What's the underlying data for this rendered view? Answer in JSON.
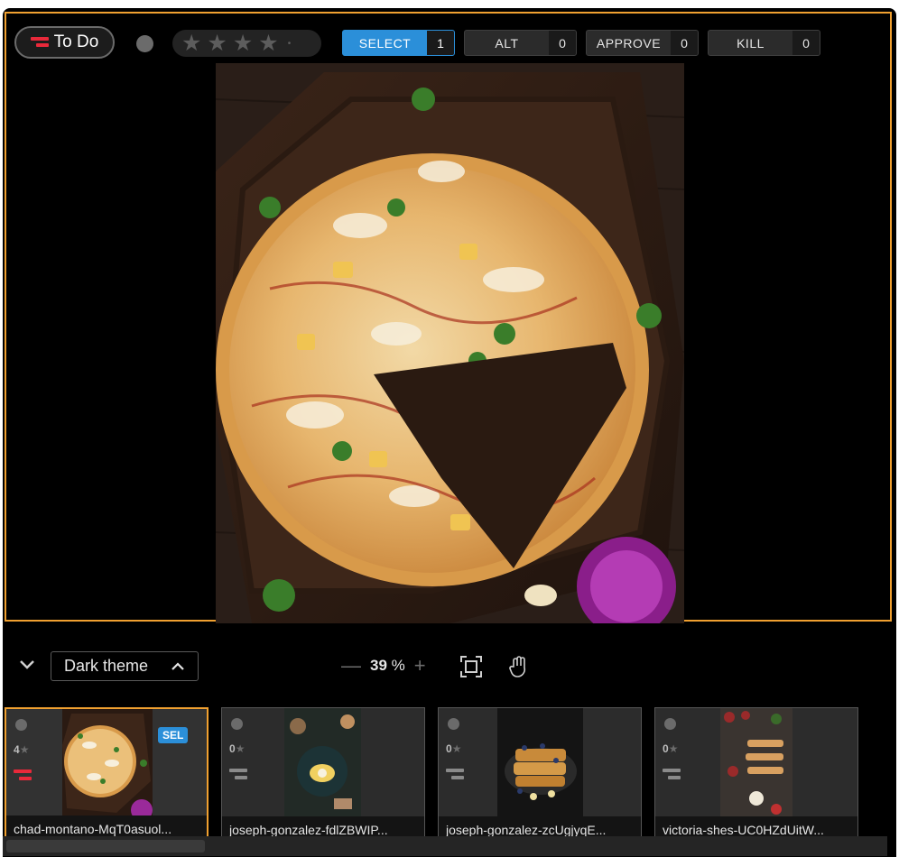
{
  "toolbar": {
    "status_label": "To Do",
    "rating_small": "•",
    "tags": [
      {
        "label": "SELECT",
        "count": "1",
        "active": true
      },
      {
        "label": "ALT",
        "count": "0",
        "active": false
      },
      {
        "label": "APPROVE",
        "count": "0",
        "active": false
      },
      {
        "label": "KILL",
        "count": "0",
        "active": false
      }
    ]
  },
  "footer": {
    "theme_label": "Dark theme",
    "zoom_value": "39",
    "zoom_unit": "%",
    "zoom_minus": "—",
    "zoom_plus": "+"
  },
  "filmstrip": [
    {
      "name": "chad-montano-MqT0asuol...",
      "stars": "4",
      "badge": "SEL",
      "flag_color": "#e8293a",
      "current": true
    },
    {
      "name": "joseph-gonzalez-fdlZBWIP...",
      "stars": "0",
      "badge": "",
      "flag_color": "#8a8a8a",
      "current": false
    },
    {
      "name": "joseph-gonzalez-zcUgjyqE...",
      "stars": "0",
      "badge": "",
      "flag_color": "#8a8a8a",
      "current": false
    },
    {
      "name": "victoria-shes-UC0HZdUitW...",
      "stars": "0",
      "badge": "",
      "flag_color": "#8a8a8a",
      "current": false
    }
  ],
  "colors": {
    "accent": "#f0a030",
    "select_blue": "#2b8fd9",
    "todo_red": "#e8293a"
  }
}
